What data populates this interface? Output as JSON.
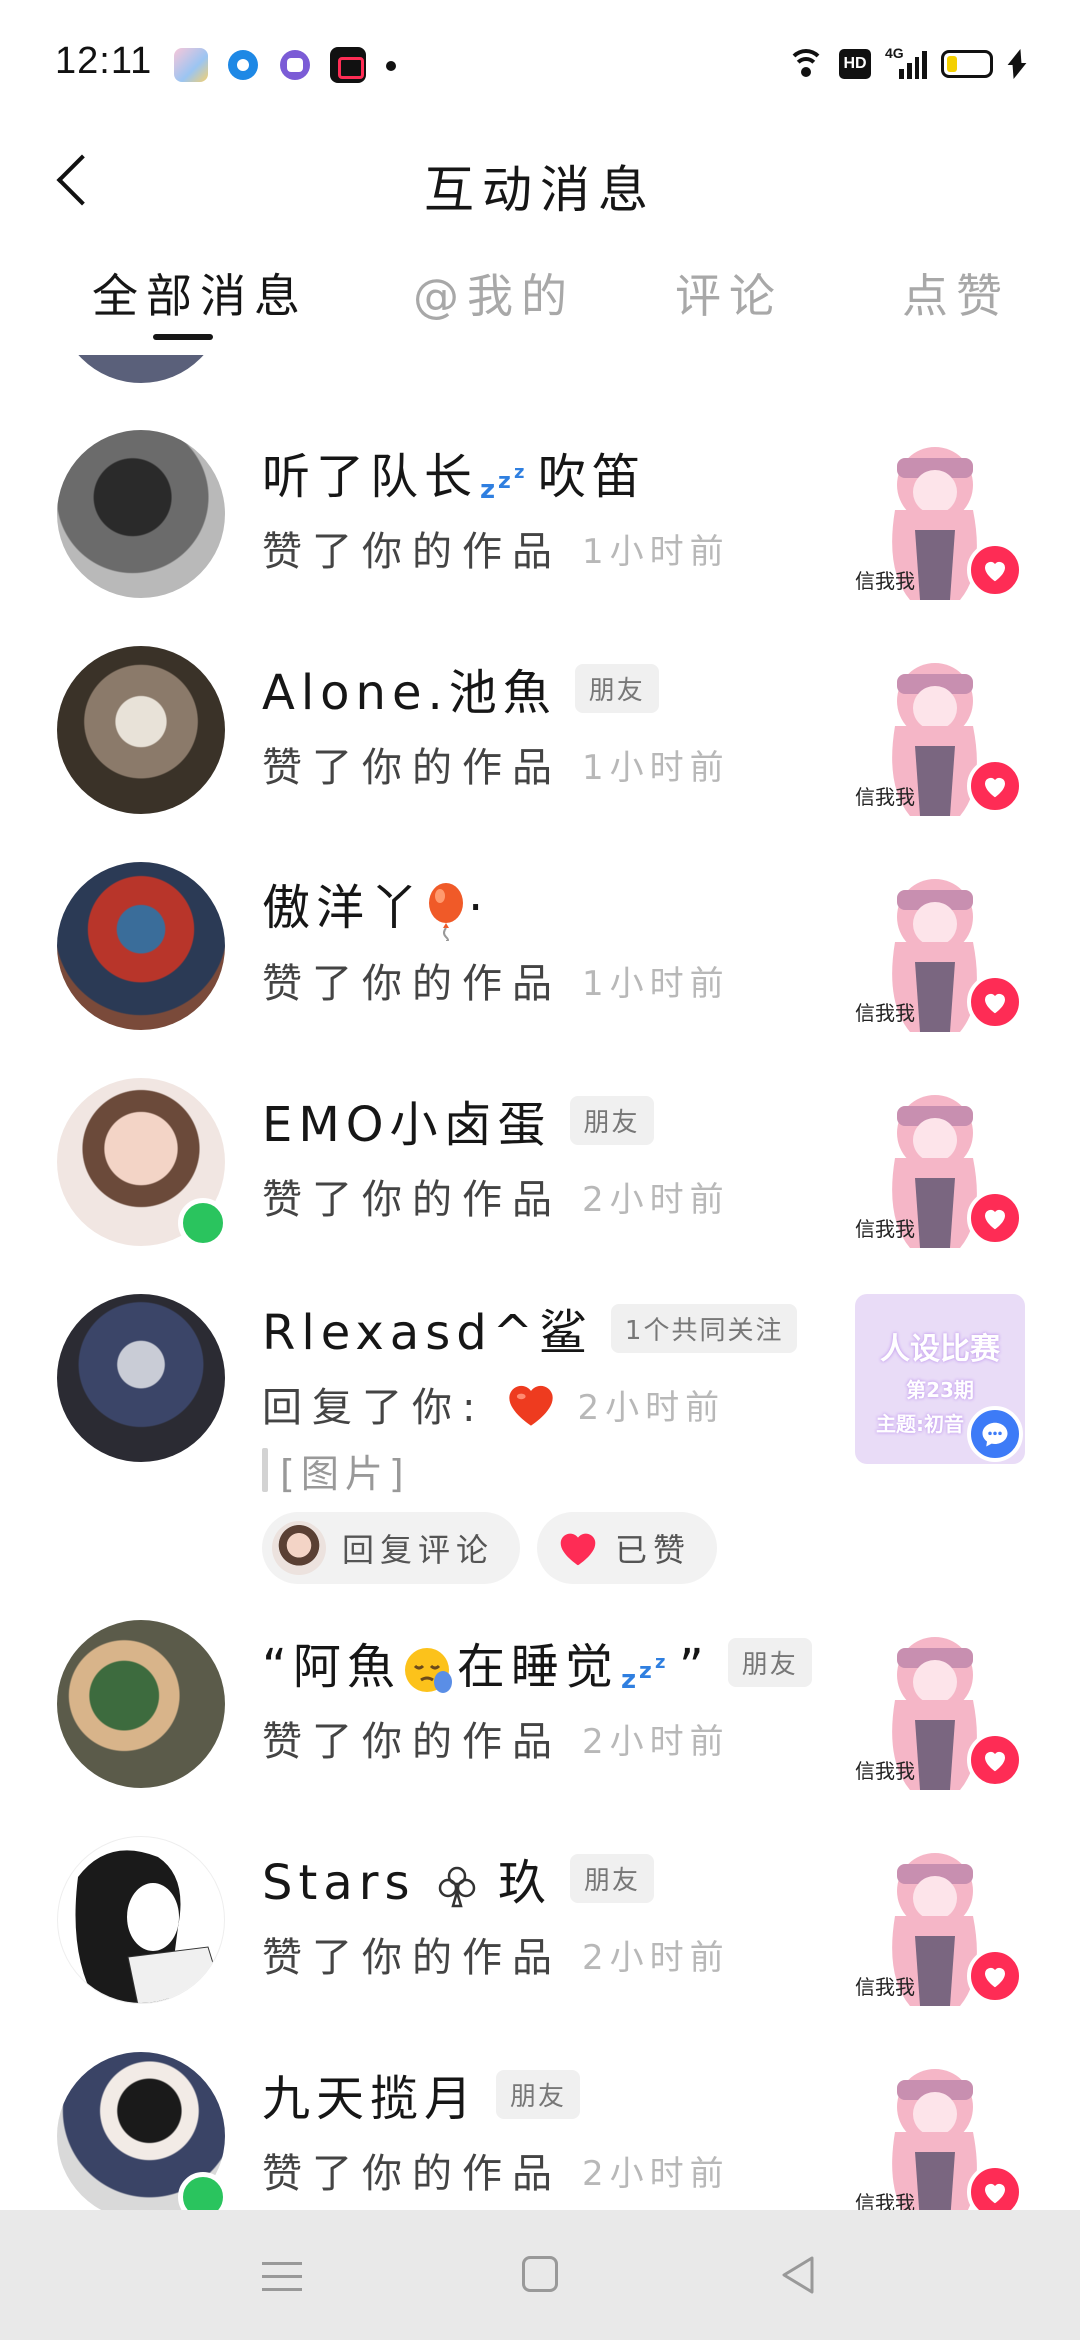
{
  "status_bar": {
    "time": "12:11",
    "hd": "HD",
    "network": "4G"
  },
  "header": {
    "title": "互动消息"
  },
  "tabs": [
    {
      "label": "全部消息",
      "active": true
    },
    {
      "label": "@我的",
      "active": false
    },
    {
      "label": "评论",
      "active": false
    },
    {
      "label": "点赞",
      "active": false
    }
  ],
  "messages": [
    {
      "name": "听了队长",
      "name_suffix": "吹笛",
      "emoji": "zzz",
      "tag": "",
      "action": "赞了你的作品",
      "time": "1小时前",
      "online": false
    },
    {
      "name": "Alone.池魚",
      "tag": "朋友",
      "action": "赞了你的作品",
      "time": "1小时前",
      "online": false
    },
    {
      "name": "傲洋丫",
      "name_suffix": "·",
      "emoji": "balloon",
      "tag": "",
      "action": "赞了你的作品",
      "time": "1小时前",
      "online": false
    },
    {
      "name": "EMO小卤蛋",
      "tag": "朋友",
      "action": "赞了你的作品",
      "time": "2小时前",
      "online": true
    },
    {
      "name": "Rlexasd^鲨",
      "tag": "1个共同关注",
      "action": "回复了你:",
      "emoji": "heart",
      "time": "2小时前",
      "quote": "[图片]",
      "reply_label": "回复评论",
      "liked_label": "已赞",
      "thumb_text": {
        "line1": "人设比赛",
        "line2": "第23期",
        "line3": "主题:初音"
      }
    },
    {
      "name": "“阿魚",
      "name_mid": "在睡觉",
      "name_suffix": "”",
      "emoji": "sleepy",
      "tag": "朋友",
      "action": "赞了你的作品",
      "time": "2小时前",
      "online": false
    },
    {
      "name": "Stars",
      "name_suffix": "玖",
      "emoji": "club",
      "tag": "朋友",
      "action": "赞了你的作品",
      "time": "2小时前",
      "online": false
    },
    {
      "name": "九天揽月",
      "tag": "朋友",
      "action": "赞了你的作品",
      "time": "2小时前",
      "online": true
    }
  ],
  "colors": {
    "like": "#fe2c55",
    "online": "#2ac45e",
    "comment": "#3d7bf7",
    "muted": "#b8b8b8"
  },
  "thumb_caption": "信我我"
}
